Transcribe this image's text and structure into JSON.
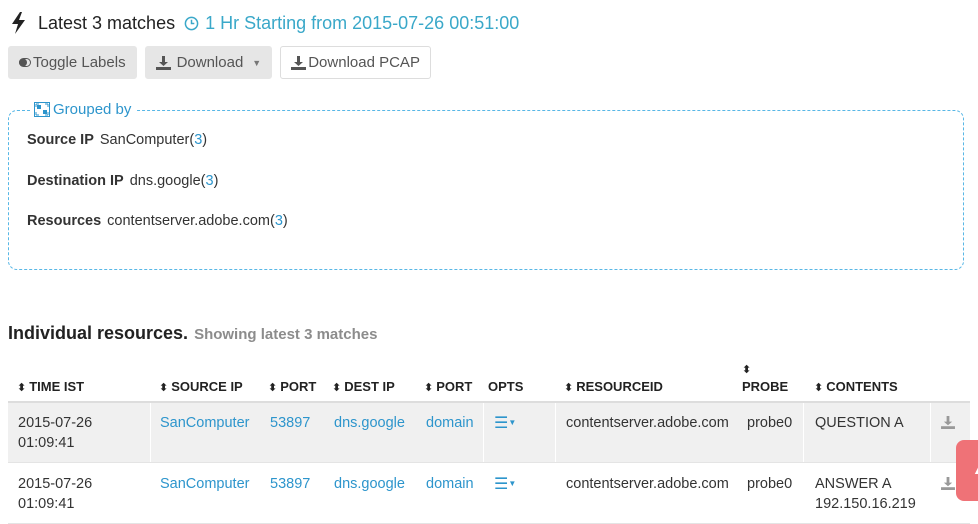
{
  "header": {
    "title": "Latest 3 matches",
    "subtitle": "1 Hr Starting from 2015-07-26 00:51:00"
  },
  "toolbar": {
    "toggle_labels": "Toggle Labels",
    "download": "Download",
    "download_pcap": "Download PCAP"
  },
  "grouped_by": {
    "legend": "Grouped by",
    "rows": [
      {
        "label": "Source IP",
        "value": "SanComputer",
        "count": "3"
      },
      {
        "label": "Destination IP",
        "value": "dns.google",
        "count": "3"
      },
      {
        "label": "Resources",
        "value": "contentserver.adobe.com",
        "count": "3"
      }
    ]
  },
  "section": {
    "title": "Individual resources.",
    "subtitle": "Showing latest 3 matches"
  },
  "table": {
    "columns": [
      "TIME IST",
      "SOURCE IP",
      "PORT",
      "DEST IP",
      "PORT",
      "OPTS",
      "RESOURCEID",
      "PROBE",
      "CONTENTS"
    ],
    "rows": [
      {
        "time1": "2015-07-26",
        "time2": "01:09:41",
        "source_ip": "SanComputer",
        "sport": "53897",
        "dest_ip": "dns.google",
        "dport": "domain",
        "resourceid": "contentserver.adobe.com",
        "probe": "probe0",
        "contents1": "QUESTION A",
        "contents2": ""
      },
      {
        "time1": "2015-07-26",
        "time2": "01:09:41",
        "source_ip": "SanComputer",
        "sport": "53897",
        "dest_ip": "dns.google",
        "dport": "domain",
        "resourceid": "contentserver.adobe.com",
        "probe": "probe0",
        "contents1": "ANSWER A",
        "contents2": "192.150.16.219"
      }
    ]
  },
  "colors": {
    "accent": "#2d95cc",
    "teal": "#3aa8c9",
    "float_button": "#ef7277"
  },
  "icons": {
    "header": "bolt-icon",
    "subtitle": "clock-icon",
    "toggle": "toggle-icon",
    "download": "download-icon",
    "legend": "group-icon",
    "opts": "list-menu-icon",
    "row_download": "download-icon"
  }
}
